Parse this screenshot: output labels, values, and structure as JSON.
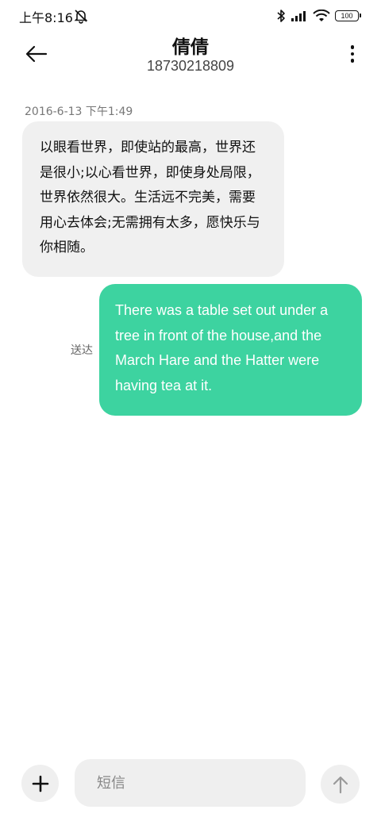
{
  "status_bar": {
    "time": "上午8:16",
    "battery": "100",
    "icons": [
      "mute-alarm-icon",
      "bluetooth-icon",
      "signal-icon",
      "wifi-icon",
      "battery-icon"
    ]
  },
  "header": {
    "contact_name": "倩倩",
    "contact_number": "18730218809",
    "back_icon": "back-arrow-icon",
    "more_icon": "more-vertical-icon"
  },
  "conversation": {
    "timestamp": "2016-6-13 下午1:49",
    "incoming_message": "以眼看世界，即使站的最高，世界还是很小;以心看世界，即使身处局限，世界依然很大。生活远不完美，需要用心去体会;无需拥有太多，愿快乐与你相随。",
    "outgoing_message": "There was a table set out under a tree in front of the house,and the March Hare and the Hatter were having tea at it.",
    "delivery_status": "送达"
  },
  "composer": {
    "placeholder": "短信",
    "value": "",
    "add_icon": "plus-icon",
    "send_icon": "arrow-up-icon"
  },
  "colors": {
    "outgoing_bubble": "#3dd3a0",
    "incoming_bubble": "#f0f0f0",
    "button_bg": "#efefef"
  }
}
